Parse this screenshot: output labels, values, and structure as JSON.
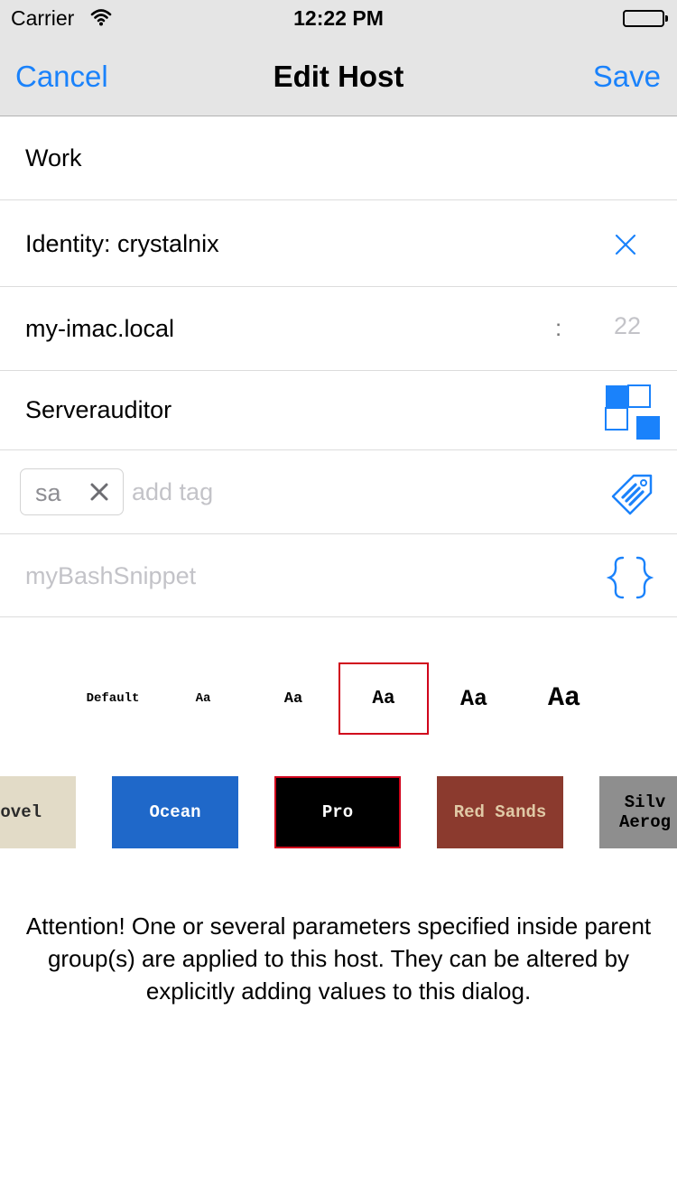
{
  "status_bar": {
    "carrier": "Carrier",
    "time": "12:22 PM"
  },
  "nav": {
    "cancel_label": "Cancel",
    "title": "Edit Host",
    "save_label": "Save"
  },
  "form": {
    "alias": "Work",
    "identity": "Identity: crystalnix",
    "hostname": "my-imac.local",
    "port_separator": ":",
    "port_placeholder": "22",
    "group": "Serverauditor",
    "tags": [
      {
        "label": "sa"
      }
    ],
    "tag_placeholder": "add tag",
    "snippet_placeholder": "myBashSnippet"
  },
  "font_sizes": {
    "options": [
      "Default",
      "Aa",
      "Aa",
      "Aa",
      "Aa",
      "Aa"
    ],
    "selected_index": 3
  },
  "themes": {
    "options": [
      {
        "label": "ovel",
        "bg": "#e2dbc7",
        "fg": "#2b2b2b"
      },
      {
        "label": "Ocean",
        "bg": "#1f68c9",
        "fg": "#ffffff"
      },
      {
        "label": "Pro",
        "bg": "#000000",
        "fg": "#ffffff"
      },
      {
        "label": "Red Sands",
        "bg": "#8b3a2e",
        "fg": "#e0c9a6"
      },
      {
        "label": "Silv\nAerog",
        "bg": "#8e8e8e",
        "fg": "#000000"
      }
    ],
    "selected_index": 2
  },
  "attention_text": "Attention! One or several parameters specified inside parent group(s) are applied to this host. They can be altered by explicitly adding values to this dialog.",
  "colors": {
    "accent": "#1a82fb",
    "selection": "#d0021b",
    "bar_bg": "#e5e5e5"
  }
}
